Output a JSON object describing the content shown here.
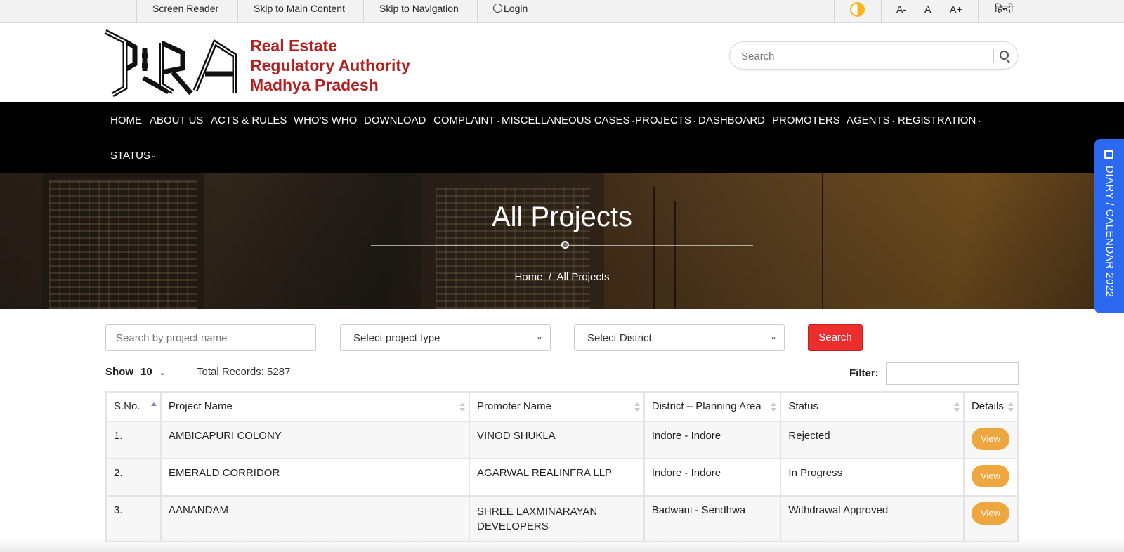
{
  "topbar": {
    "screen_reader": "Screen Reader",
    "skip_main": "Skip to Main Content",
    "skip_nav": "Skip to Navigation",
    "login": "Login",
    "font_decrease": "A-",
    "font_normal": "A",
    "font_increase": "A+",
    "language": "हिन्दी"
  },
  "header": {
    "org_line1": "Real Estate",
    "org_line2": "Regulatory Authority",
    "org_line3": "Madhya Pradesh",
    "search_placeholder": "Search"
  },
  "nav": {
    "items": [
      {
        "label": "HOME"
      },
      {
        "label": "ABOUT US"
      },
      {
        "label": "ACTS & RULES"
      },
      {
        "label": "WHO'S WHO"
      },
      {
        "label": "DOWNLOAD"
      },
      {
        "label": "COMPLAINT"
      },
      {
        "label": "MISCELLANEOUS CASES"
      },
      {
        "label": "PROJECTS"
      },
      {
        "label": "DASHBOARD"
      },
      {
        "label": "PROMOTERS"
      },
      {
        "label": "AGENTS"
      },
      {
        "label": "REGISTRATION"
      },
      {
        "label": "STATUS"
      }
    ]
  },
  "hero": {
    "title": "All Projects",
    "breadcrumb_home": "Home",
    "breadcrumb_sep": "/",
    "breadcrumb_current": "All Projects"
  },
  "diary_tab": "DIARY / CALENDAR 2022",
  "filters": {
    "project_name_placeholder": "Search by project name",
    "project_type": "Select project type",
    "district": "Select District",
    "search_button": "Search"
  },
  "listing": {
    "show_label": "Show",
    "show_value": "10",
    "total_records": "Total Records: 5287",
    "filter_label": "Filter:"
  },
  "table": {
    "headers": [
      "S.No.",
      "Project Name",
      "Promoter Name",
      "District – Planning Area",
      "Status",
      "Details"
    ],
    "rows": [
      {
        "sno": "1.",
        "project": "AMBICAPURI COLONY",
        "promoter": "VINOD SHUKLA",
        "district": "Indore  -  Indore",
        "status": "Rejected",
        "details": "View"
      },
      {
        "sno": "2.",
        "project": "EMERALD CORRIDOR",
        "promoter": "AGARWAL REALINFRA LLP",
        "district": "Indore  -  Indore",
        "status": "In Progress",
        "details": "View"
      },
      {
        "sno": "3.",
        "project": "AANANDAM",
        "promoter": "SHREE LAXMINARAYAN DEVELOPERS",
        "district": "Badwani  -  Sendhwa",
        "status": "Withdrawal Approved",
        "details": "View"
      }
    ]
  },
  "colors": {
    "brand_red": "#b41e1e",
    "nav_bg": "#000000",
    "search_button": "#ee2d2d",
    "view_button": "#eea73f",
    "diary_tab": "#2b6af0"
  }
}
